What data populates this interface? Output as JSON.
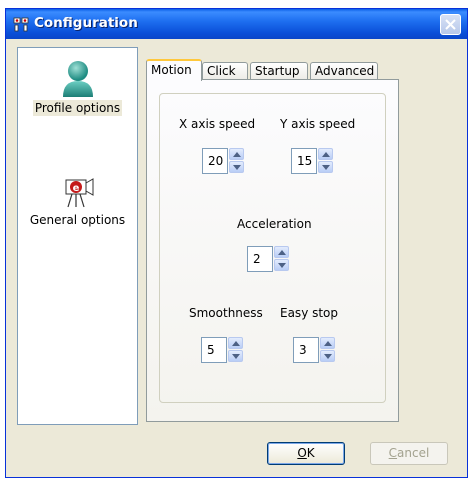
{
  "window": {
    "title": "Configuration"
  },
  "sidebar": {
    "items": [
      {
        "label": "Profile options",
        "icon": "user-profile-icon",
        "selected": true
      },
      {
        "label": "General options",
        "icon": "camera-exclamation-icon",
        "selected": false
      }
    ]
  },
  "tabs": [
    {
      "label": "Motion",
      "active": true
    },
    {
      "label": "Click",
      "active": false
    },
    {
      "label": "Startup",
      "active": false
    },
    {
      "label": "Advanced",
      "active": false
    }
  ],
  "motion": {
    "x_axis_speed": {
      "label": "X axis speed",
      "value": "20"
    },
    "y_axis_speed": {
      "label": "Y axis speed",
      "value": "15"
    },
    "acceleration": {
      "label": "Acceleration",
      "value": "2"
    },
    "smoothness": {
      "label": "Smoothness",
      "value": "5"
    },
    "easy_stop": {
      "label": "Easy stop",
      "value": "3"
    }
  },
  "buttons": {
    "ok_label_underlined": "O",
    "ok_label_rest": "K",
    "cancel_label_underlined": "C",
    "cancel_label_rest": "ancel"
  },
  "colors": {
    "titlebar": "#0a5fe6",
    "dialog_bg": "#ece9d8",
    "active_tab_accent": "#ffc83c"
  }
}
